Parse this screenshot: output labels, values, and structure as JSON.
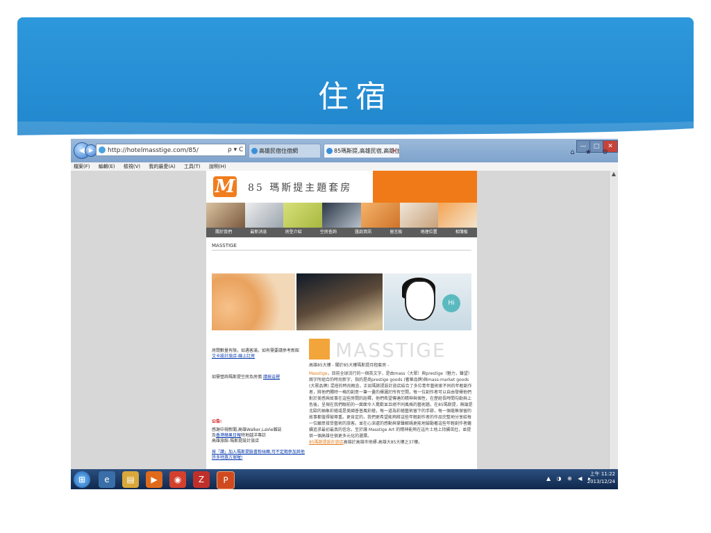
{
  "slide": {
    "title": "住宿"
  },
  "browser": {
    "address": "http://hotelmasstige.com/85/",
    "address_tools": "ρ ▾ C",
    "tabs": [
      {
        "label": "高雄民宿住宿網",
        "active": false
      },
      {
        "label": "85瑪斯提,高雄民宿,高雄住...",
        "active": true
      }
    ],
    "tab_close": "×",
    "menu": [
      "檔案(F)",
      "編輯(E)",
      "檢視(V)",
      "我的最愛(A)",
      "工具(T)",
      "說明(H)"
    ],
    "window_controls": [
      "—",
      "□",
      "✕"
    ]
  },
  "site": {
    "logo_letter": "M",
    "brand": "85 瑪斯提主題套房",
    "nav": [
      "關於我們",
      "最新消息",
      "房型介紹",
      "空房查詢",
      "匯款資訊",
      "留言板",
      "地理位置",
      "相簿板"
    ],
    "breadcrumb": "MASSTIGE",
    "left": {
      "p1": "房間數量有限，如遇客滿，如有需要請參考新館",
      "link1": "艾卡設計旅店-線上訂房",
      "p2": "如需營詢瑪斯提空房及房價",
      "link2": "請按這裡",
      "notice_label": "公告:",
      "p3a": "感謝中視新聞,高雄Walker,LaVie雜誌",
      "p3b": "及",
      "link3": "香港蘋果日報",
      "p3c": "特地越洋專訪",
      "p3d": "高雄旅館-瑪斯提設計旅店",
      "link4": "按「讚」加入瑪斯提臉書粉絲團,可不定期參加其他許多特惠方案喔!"
    },
    "masstige_logo": "MASSTIGE",
    "right": {
      "intro": "高雄85大樓 - 關於85大樓瑪斯提月租套房 -",
      "lead": "Masstige",
      "body": "，目前全球流行的一個英文字，是由mass（大眾）與prestige（魅力，聲望）兩字所組合的時尚新字，指的是商prestige goods (奢華品牌)與mass-market goods (大眾品牌) 混搭的時尚概念，正如瑪斯提設計旅店結合了多位青年藝術家不同的年輕創作者，將他們獨特一格的創意一筆一畫的揮灑於所有空間，每一位創作者可以自由發揮他們對於美感與故事在這些房間的詮釋，他們希望傳達的精神與個性，在歷經長時間勾勒與上色後，呈現在我們眼前的一面面令人驚歎並且絕不同風格的藝術牆，在85瑪斯提，無論是北歐的抽象彩繪或是美國普普風彩繪，每一道為彩繪藝術留下的手跡，每一個毫無保留的故事都值得被尊重。更肯定的，我們更希望能夠將這些年輕創作者的作品完整地分享給每一位願意接受藝術的旅客。並在心深處的感動與掌聲解碼更能地鼓勵著這些年輕創作者繼續追求最初最真的信念，至於讓 Masstige Art 的精神能夠在這片土地上持續茁壯，並提供一個高雄住宿更多元化的選擇。",
      "tail_link": "85瑪斯提設計旅店",
      "tail": "高雄於高雄市地標-高雄大85大樓之37樓。"
    },
    "hero_badge": "Hi"
  },
  "taskbar": {
    "items": [
      "start-orb",
      "ie",
      "explorer",
      "media",
      "chrome",
      "filezilla",
      "powerpoint"
    ],
    "tray": "▲ ◑ ⊕ ◀ ▸",
    "time": "上午 11:22",
    "date": "2013/12/24"
  },
  "colors": {
    "slide_blue": "#2e98dc",
    "site_orange": "#f07a17",
    "nav_gray": "#5c5c5c"
  }
}
